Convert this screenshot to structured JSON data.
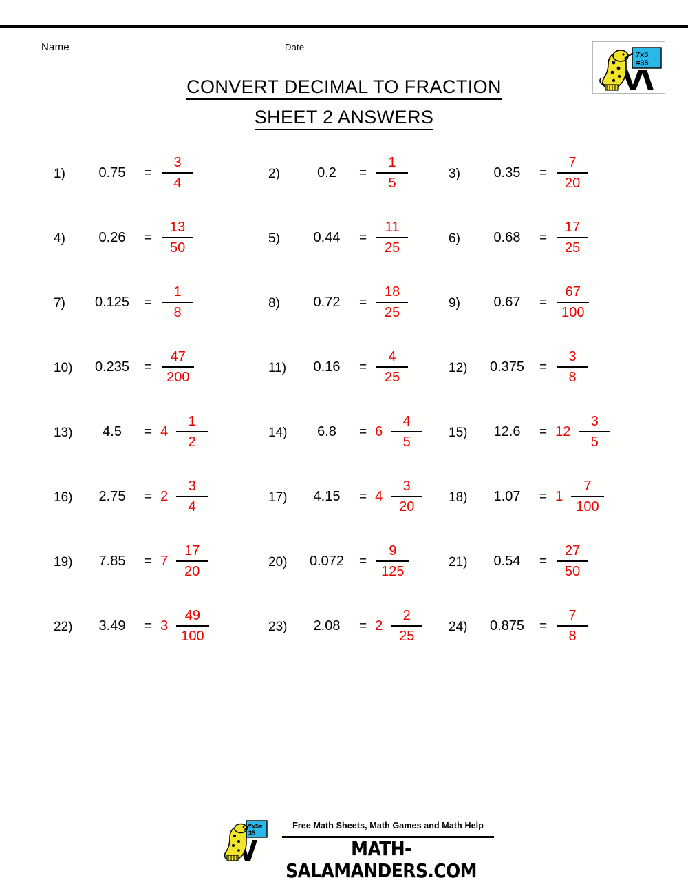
{
  "header": {
    "name_label": "Name",
    "date_label": "Date",
    "title_line1": "CONVERT DECIMAL TO FRACTION",
    "title_line2": "SHEET 2 ANSWERS",
    "logo_alt": "salamander-logo",
    "logo_board_line1": "7x5",
    "logo_board_line2": "=35"
  },
  "colors": {
    "answer_red": "#ee0000",
    "text_black": "#000000",
    "page_background": "#fffffd",
    "logo_yellow": "#f2e42a",
    "logo_board_blue": "#29b8e8"
  },
  "equals_sign": "=",
  "problems": [
    [
      {
        "number": "1)",
        "decimal": "0.75",
        "whole": "",
        "numerator": "3",
        "denominator": "4"
      },
      {
        "number": "2)",
        "decimal": "0.2",
        "whole": "",
        "numerator": "1",
        "denominator": "5"
      },
      {
        "number": "3)",
        "decimal": "0.35",
        "whole": "",
        "numerator": "7",
        "denominator": "20"
      }
    ],
    [
      {
        "number": "4)",
        "decimal": "0.26",
        "whole": "",
        "numerator": "13",
        "denominator": "50"
      },
      {
        "number": "5)",
        "decimal": "0.44",
        "whole": "",
        "numerator": "11",
        "denominator": "25"
      },
      {
        "number": "6)",
        "decimal": "0.68",
        "whole": "",
        "numerator": "17",
        "denominator": "25"
      }
    ],
    [
      {
        "number": "7)",
        "decimal": "0.125",
        "whole": "",
        "numerator": "1",
        "denominator": "8"
      },
      {
        "number": "8)",
        "decimal": "0.72",
        "whole": "",
        "numerator": "18",
        "denominator": "25"
      },
      {
        "number": "9)",
        "decimal": "0.67",
        "whole": "",
        "numerator": "67",
        "denominator": "100"
      }
    ],
    [
      {
        "number": "10)",
        "decimal": "0.235",
        "whole": "",
        "numerator": "47",
        "denominator": "200"
      },
      {
        "number": "11)",
        "decimal": "0.16",
        "whole": "",
        "numerator": "4",
        "denominator": "25"
      },
      {
        "number": "12)",
        "decimal": "0.375",
        "whole": "",
        "numerator": "3",
        "denominator": "8"
      }
    ],
    [
      {
        "number": "13)",
        "decimal": "4.5",
        "whole": "4",
        "numerator": "1",
        "denominator": "2"
      },
      {
        "number": "14)",
        "decimal": "6.8",
        "whole": "6",
        "numerator": "4",
        "denominator": "5"
      },
      {
        "number": "15)",
        "decimal": "12.6",
        "whole": "12",
        "numerator": "3",
        "denominator": "5"
      }
    ],
    [
      {
        "number": "16)",
        "decimal": "2.75",
        "whole": "2",
        "numerator": "3",
        "denominator": "4"
      },
      {
        "number": "17)",
        "decimal": "4.15",
        "whole": "4",
        "numerator": "3",
        "denominator": "20"
      },
      {
        "number": "18)",
        "decimal": "1.07",
        "whole": "1",
        "numerator": "7",
        "denominator": "100"
      }
    ],
    [
      {
        "number": "19)",
        "decimal": "7.85",
        "whole": "7",
        "numerator": "17",
        "denominator": "20"
      },
      {
        "number": "20)",
        "decimal": "0.072",
        "whole": "",
        "numerator": "9",
        "denominator": "125"
      },
      {
        "number": "21)",
        "decimal": "0.54",
        "whole": "",
        "numerator": "27",
        "denominator": "50"
      }
    ],
    [
      {
        "number": "22)",
        "decimal": "3.49",
        "whole": "3",
        "numerator": "49",
        "denominator": "100"
      },
      {
        "number": "23)",
        "decimal": "2.08",
        "whole": "2",
        "numerator": "2",
        "denominator": "25"
      },
      {
        "number": "24)",
        "decimal": "0.875",
        "whole": "",
        "numerator": "7",
        "denominator": "8"
      }
    ]
  ],
  "footer": {
    "tagline": "Free Math Sheets, Math Games and Math Help",
    "website": "MATH-SALAMANDERS.COM",
    "logo_board_line1": "7x5=",
    "logo_board_line2": "35"
  }
}
